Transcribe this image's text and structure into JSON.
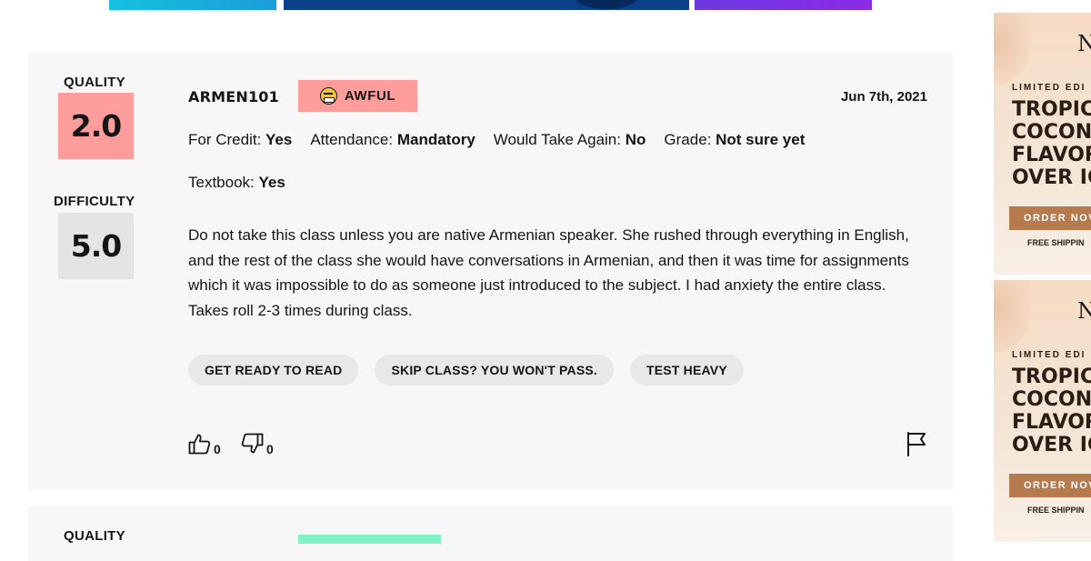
{
  "colors": {
    "quality_box": "#ff9c9c",
    "difficulty_box": "#e4e4e4",
    "card_bg": "#f7f7f7",
    "tag_bg": "#e8e8e8",
    "next_emotion_tag": "#7ff1c2"
  },
  "rating": {
    "quality_label": "QUALITY",
    "quality_score": "2.0",
    "difficulty_label": "DIFFICULTY",
    "difficulty_score": "5.0",
    "course": "ARMEN101",
    "emotion_icon": "awful-face-icon",
    "emotion": "AWFUL",
    "date": "Jun 7th, 2021",
    "meta": {
      "for_credit_label": "For Credit:",
      "for_credit_value": "Yes",
      "attendance_label": "Attendance:",
      "attendance_value": "Mandatory",
      "take_again_label": "Would Take Again:",
      "take_again_value": "No",
      "grade_label": "Grade:",
      "grade_value": "Not sure yet",
      "textbook_label": "Textbook:",
      "textbook_value": "Yes"
    },
    "comment": "Do not take this class unless you are native Armenian speaker. She rushed through everything in English, and the rest of the class she would have conversations in Armenian, and then it was time for assignments which it was impossible to do as someone just introduced to the subject. I had anxiety the entire class. Takes roll 2-3 times during class.",
    "tags": [
      "GET READY TO READ",
      "SKIP CLASS? YOU WON'T PASS.",
      "TEST HEAVY"
    ],
    "helpful_icon": "thumbs-up-icon",
    "helpful_count": "0",
    "not_helpful_icon": "thumbs-down-icon",
    "not_helpful_count": "0",
    "report_icon": "flag-icon"
  },
  "next_rating": {
    "quality_label": "QUALITY"
  },
  "ads": [
    {
      "kicker": "LIMITED EDI",
      "headline_lines": [
        "TROPIC",
        "COCON",
        "FLAVOR",
        "OVER IC"
      ],
      "button": "ORDER NOV",
      "footer": "FREE SHIPPIN"
    },
    {
      "kicker": "LIMITED EDI",
      "headline_lines": [
        "TROPIC",
        "COCON",
        "FLAVOR",
        "OVER IC"
      ],
      "button": "ORDER NOV",
      "footer": "FREE SHIPPIN"
    }
  ]
}
